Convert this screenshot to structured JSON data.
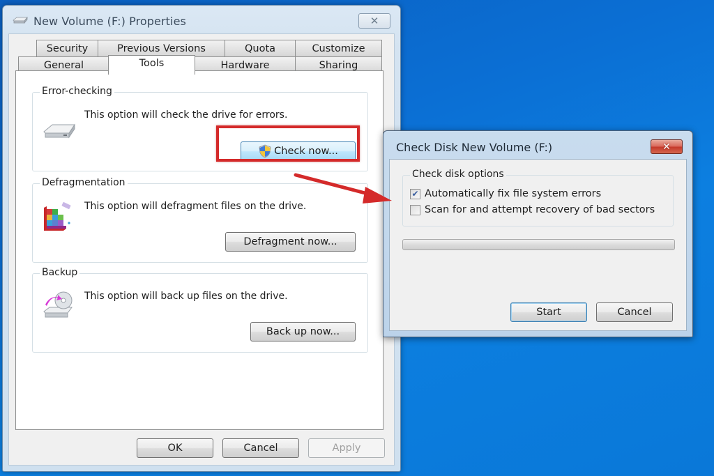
{
  "desktop": {
    "background": "#0b6fd4"
  },
  "properties_window": {
    "title": "New Volume (F:) Properties",
    "title_icon": "drive-icon",
    "close_label": "✕",
    "tabs_row1": [
      {
        "label": "Security"
      },
      {
        "label": "Previous Versions"
      },
      {
        "label": "Quota"
      },
      {
        "label": "Customize"
      }
    ],
    "tabs_row2": [
      {
        "label": "General"
      },
      {
        "label": "Tools",
        "active": true
      },
      {
        "label": "Hardware"
      },
      {
        "label": "Sharing"
      }
    ],
    "groups": [
      {
        "legend": "Error-checking",
        "description": "This option will check the drive for errors.",
        "icon": "hard-drive-icon",
        "button": {
          "label": "Check now...",
          "icon": "uac-shield-icon",
          "highlighted": true
        }
      },
      {
        "legend": "Defragmentation",
        "description": "This option will defragment files on the drive.",
        "icon": "defragment-icon",
        "button": {
          "label": "Defragment now..."
        }
      },
      {
        "legend": "Backup",
        "description": "This option will back up files on the drive.",
        "icon": "backup-icon",
        "button": {
          "label": "Back up now..."
        }
      }
    ],
    "footer": {
      "ok": "OK",
      "cancel": "Cancel",
      "apply": "Apply",
      "apply_disabled": true
    }
  },
  "annotation": {
    "highlight_color": "#d42a2a",
    "arrow_color": "#d42a2a"
  },
  "check_disk_dialog": {
    "title": "Check Disk New Volume (F:)",
    "close_label": "✕",
    "group_legend": "Check disk options",
    "options": [
      {
        "label": "Automatically fix file system errors",
        "checked": true
      },
      {
        "label": "Scan for and attempt recovery of bad sectors",
        "checked": false
      }
    ],
    "progress_percent": 0,
    "start": "Start",
    "cancel": "Cancel"
  }
}
